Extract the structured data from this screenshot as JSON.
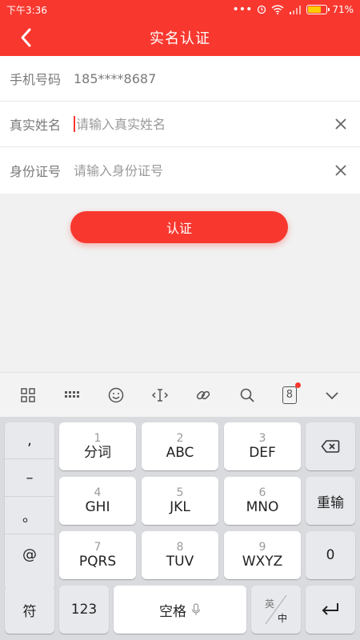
{
  "status_bar": {
    "time": "下午3:36",
    "battery": "71%",
    "battery_fill": 0.71
  },
  "nav": {
    "title": "实名认证"
  },
  "form": {
    "phone": {
      "label": "手机号码",
      "value": "185****8687"
    },
    "name": {
      "label": "真实姓名",
      "placeholder": "请输入真实姓名"
    },
    "id_number": {
      "label": "身份证号",
      "placeholder": "请输入身份证号"
    }
  },
  "submit_label": "认证",
  "keyboard": {
    "punct": [
      ",",
      "–",
      "。",
      "@"
    ],
    "keys": [
      {
        "num": "1",
        "main": "分词"
      },
      {
        "num": "2",
        "main": "ABC"
      },
      {
        "num": "3",
        "main": "DEF"
      },
      {
        "num": "4",
        "main": "GHI"
      },
      {
        "num": "5",
        "main": "JKL"
      },
      {
        "num": "6",
        "main": "MNO"
      },
      {
        "num": "7",
        "main": "PQRS"
      },
      {
        "num": "8",
        "main": "TUV"
      },
      {
        "num": "9",
        "main": "WXYZ"
      }
    ],
    "reinput": "重输",
    "zero": "0",
    "symbol": "符",
    "num_mode": "123",
    "space": "空格",
    "lang_top": "英",
    "lang_bottom": "中",
    "toolbar_badge_number": "8"
  },
  "colors": {
    "accent": "#f8382f"
  }
}
